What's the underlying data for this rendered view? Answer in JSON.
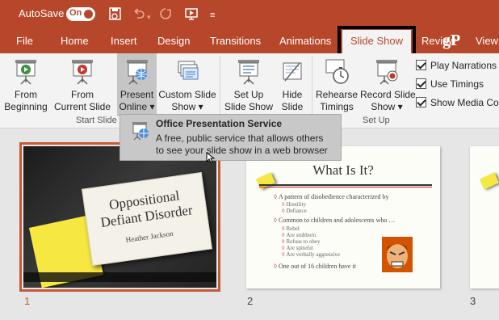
{
  "titlebar": {
    "autosave_label": "AutoSave",
    "autosave_state": "On",
    "icons": [
      "save-icon",
      "undo-icon",
      "undo-dropdown-icon",
      "redo-icon",
      "present-from-beginning-icon",
      "customize-qat-icon"
    ]
  },
  "tabs": [
    "File",
    "Home",
    "Insert",
    "Design",
    "Transitions",
    "Animations",
    "Slide Show",
    "Review",
    "View"
  ],
  "active_tab": "Slide Show",
  "watermark": "gP",
  "ribbon": {
    "start_slide_show": {
      "group_label": "Start Slide Show",
      "from_beginning": [
        "From",
        "Beginning"
      ],
      "from_current": [
        "From",
        "Current Slide"
      ],
      "present_online": [
        "Present",
        "Online ▾"
      ],
      "custom_slide_show": [
        "Custom Slide",
        "Show ▾"
      ]
    },
    "set_up": {
      "group_label": "Set Up",
      "set_up_slide_show": [
        "Set Up",
        "Slide Show"
      ],
      "hide_slide": [
        "Hide",
        "Slide"
      ],
      "rehearse_timings": [
        "Rehearse",
        "Timings"
      ],
      "record_slide_show": [
        "Record Slide",
        "Show ▾"
      ],
      "checkboxes": [
        "Play Narrations",
        "Use Timings",
        "Show Media Co"
      ]
    }
  },
  "tooltip": {
    "title": "Office Presentation Service",
    "line1": "A free, public service that allows others",
    "line2": "to see your slide show in a web browser"
  },
  "slides": {
    "slide1": {
      "number": "1",
      "title_line1": "Oppositional",
      "title_line2": "Defiant Disorder",
      "subtitle": "Heather Jackson"
    },
    "slide2": {
      "number": "2",
      "title": "What Is It?",
      "bullets": [
        "A pattern of disobedience characterized by",
        "Hostility",
        "Defiance",
        "Common to children and adolescents who …",
        "Rebel",
        "Are stubborn",
        "Refuse to obey",
        "Are spiteful",
        "Are verbally aggressive",
        "One out of 16 children have it"
      ]
    },
    "slide3": {
      "number": "3"
    }
  },
  "colors": {
    "accent": "#b7472a",
    "selection": "#c55a36",
    "ribbon": "#f3f3f3"
  }
}
